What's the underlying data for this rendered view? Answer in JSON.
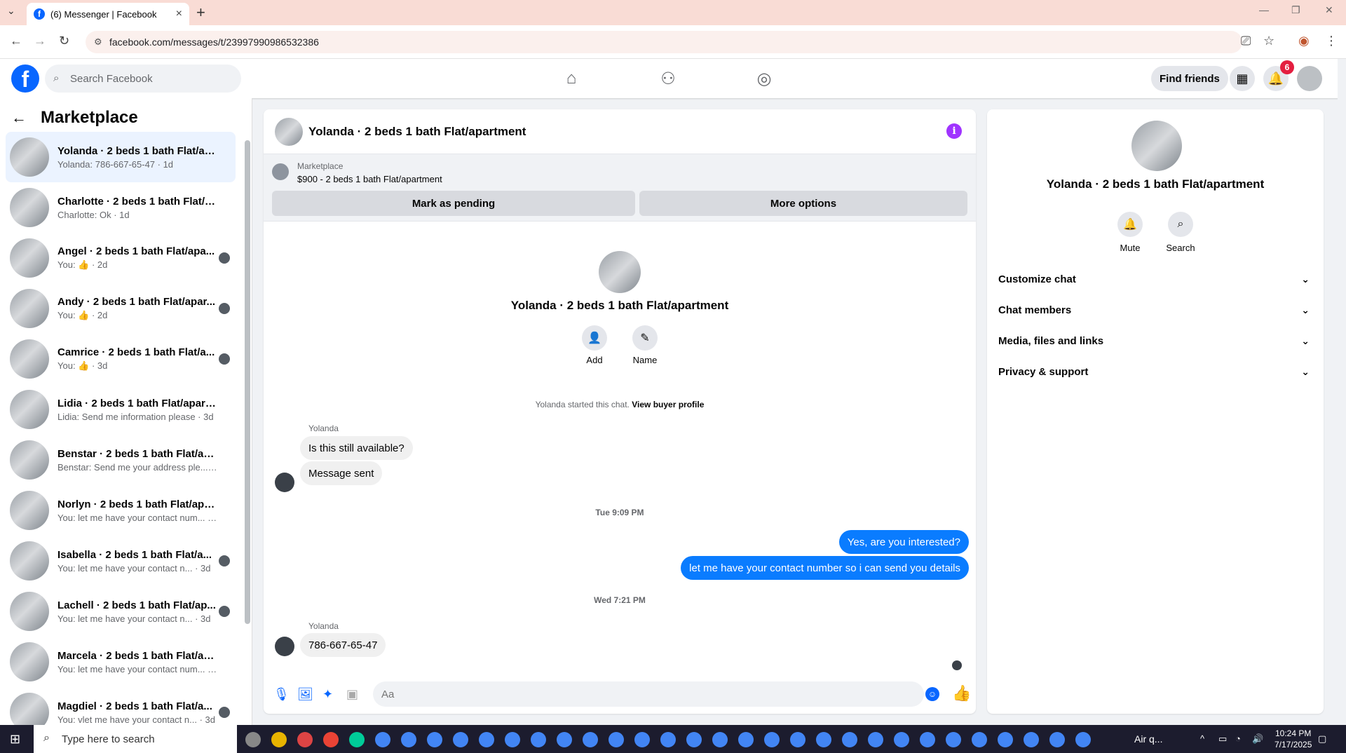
{
  "browser": {
    "tab_title": "(6) Messenger | Facebook",
    "url": "facebook.com/messages/t/23997990986532386"
  },
  "header": {
    "search_placeholder": "Search Facebook",
    "find_friends": "Find friends",
    "notif_count": "6"
  },
  "sidebar": {
    "title": "Marketplace",
    "conversations": [
      {
        "title": "Yolanda · 2 beds 1 bath Flat/apa...",
        "sub": "Yolanda: 786-667-65-47 · 1d"
      },
      {
        "title": "Charlotte · 2 beds 1 bath Flat/ap...",
        "sub": "Charlotte: Ok · 1d"
      },
      {
        "title": "Angel · 2 beds 1 bath Flat/apa...",
        "sub": "You: 👍 · 2d"
      },
      {
        "title": "Andy · 2 beds 1 bath Flat/apar...",
        "sub": "You: 👍 · 2d"
      },
      {
        "title": "Camrice · 2 beds 1 bath Flat/a...",
        "sub": "You: 👍 · 3d"
      },
      {
        "title": "Lidia · 2 beds 1 bath Flat/apartm...",
        "sub": "Lidia: Send me information please · 3d"
      },
      {
        "title": "Benstar · 2 beds 1 bath Flat/apar...",
        "sub": "Benstar: Send me your address ple... · 3d"
      },
      {
        "title": "Norlyn · 2 beds 1 bath Flat/apart...",
        "sub": "You: let me have your contact num... · 3d"
      },
      {
        "title": "Isabella · 2 beds 1 bath Flat/a...",
        "sub": "You: let me have your contact n... · 3d"
      },
      {
        "title": "Lachell · 2 beds 1 bath Flat/ap...",
        "sub": "You: let me have your contact n... · 3d"
      },
      {
        "title": "Marcela · 2 beds 1 bath Flat/apa...",
        "sub": "You: let me have your contact num... · 3d"
      },
      {
        "title": "Magdiel · 2 beds 1 bath Flat/a...",
        "sub": "You: vlet me have your contact n... · 3d"
      }
    ]
  },
  "chat": {
    "name": "Yolanda · 2 beds 1 bath Flat/apartment",
    "marketplace_label": "Marketplace",
    "listing": "$900 - 2 beds 1 bath Flat/apartment",
    "mark_pending": "Mark as pending",
    "more_options": "More options",
    "add_label": "Add",
    "name_label": "Name",
    "started_text": "Yolanda started this chat.",
    "view_profile": "View buyer profile",
    "sender_name": "Yolanda",
    "msg1": "Is this still available?",
    "msg2": "Message sent",
    "ts1": "Tue 9:09 PM",
    "out1": "Yes, are you interested?",
    "out2": "let me have your contact number so i can send you details",
    "ts2": "Wed 7:21 PM",
    "msg3": "786-667-65-47",
    "composer_placeholder": "Aa"
  },
  "details": {
    "name": "Yolanda · 2 beds 1 bath Flat/apartment",
    "mute": "Mute",
    "search": "Search",
    "rows": [
      "Customize chat",
      "Chat members",
      "Media, files and links",
      "Privacy & support"
    ]
  },
  "taskbar": {
    "search_placeholder": "Type here to search",
    "weather": "Air q...",
    "time": "10:24 PM",
    "date": "7/17/2025"
  }
}
